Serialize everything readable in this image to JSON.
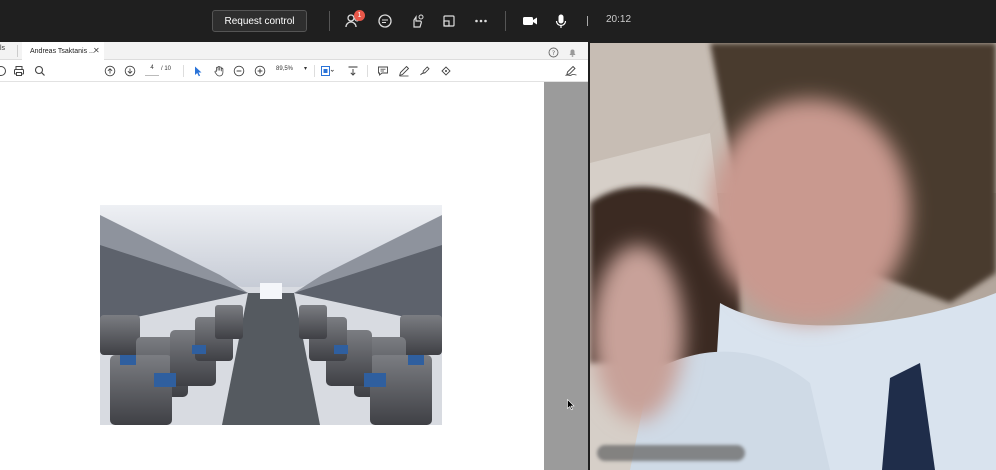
{
  "topbar": {
    "request_control_label": "Request control",
    "participants_badge": "1",
    "clock": "20:12",
    "icons": [
      "people-icon",
      "chat-icon",
      "reactions-icon",
      "share-screen-icon",
      "more-icon",
      "camera-icon",
      "mic-icon"
    ]
  },
  "pdf": {
    "tab_prev_label": "ls",
    "tab_active_label": "Andreas Tsaktanis ...",
    "page_current": "4",
    "page_total": "/ 10",
    "zoom": "89,5%",
    "image_subject": "aircraft-cabin-image"
  },
  "colors": {
    "app_background": "#1f1f1f",
    "badge": "#e9584a",
    "accent_blue": "#2a73d8"
  }
}
